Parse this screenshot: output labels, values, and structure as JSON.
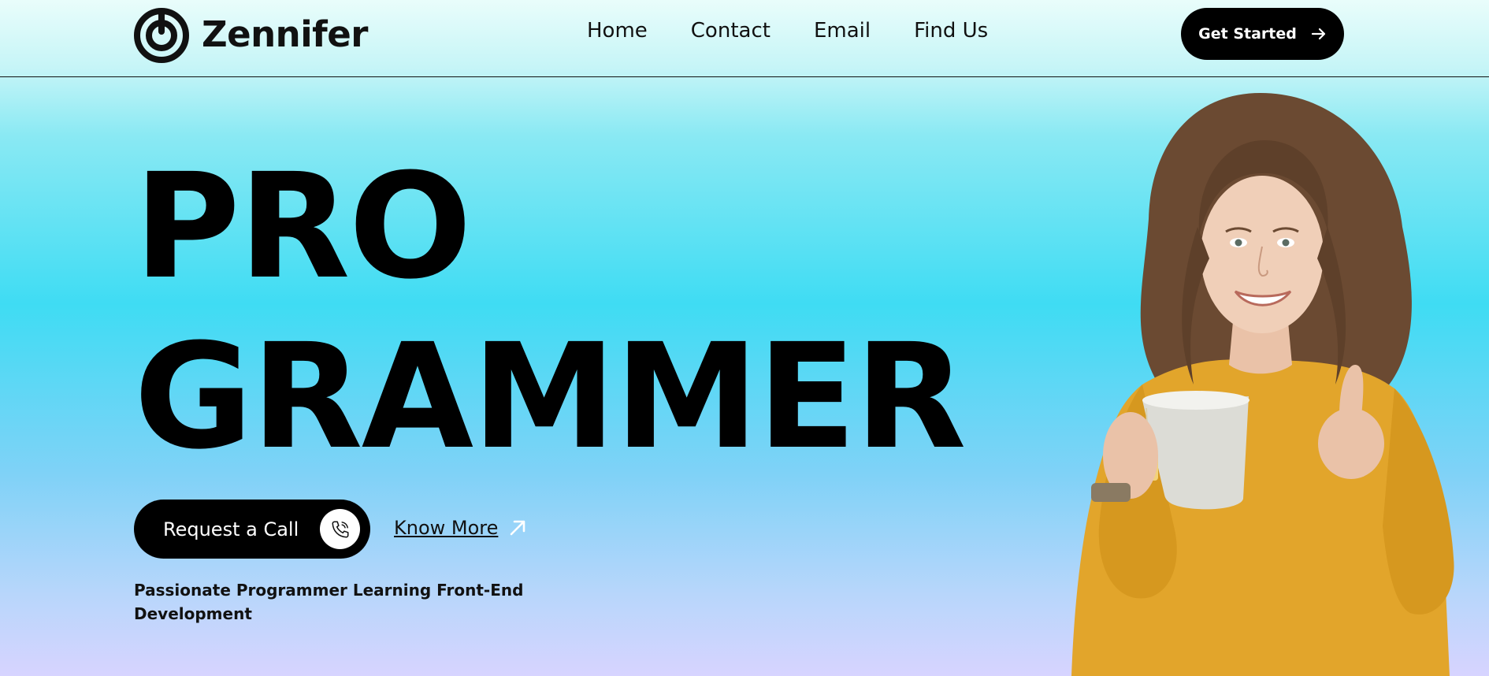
{
  "brand": {
    "name": "Zennifer"
  },
  "nav": {
    "items": [
      {
        "label": "Home"
      },
      {
        "label": "Contact"
      },
      {
        "label": "Email"
      },
      {
        "label": "Find Us"
      }
    ]
  },
  "header": {
    "cta_label": "Get Started"
  },
  "hero": {
    "line1": "PRO",
    "line2": "GRAMMER",
    "call_label": "Request a Call",
    "know_more_label": "Know More",
    "tagline": "Passionate Programmer Learning Front-End Development"
  },
  "icons": {
    "logo": "target-logo-icon",
    "cta": "arrow-right-icon",
    "call": "phone-icon",
    "know_more": "arrow-up-right-icon"
  },
  "colors": {
    "primary": "#000000",
    "accent_bg": "#3fdcf3",
    "sweater": "#e2a52b"
  }
}
